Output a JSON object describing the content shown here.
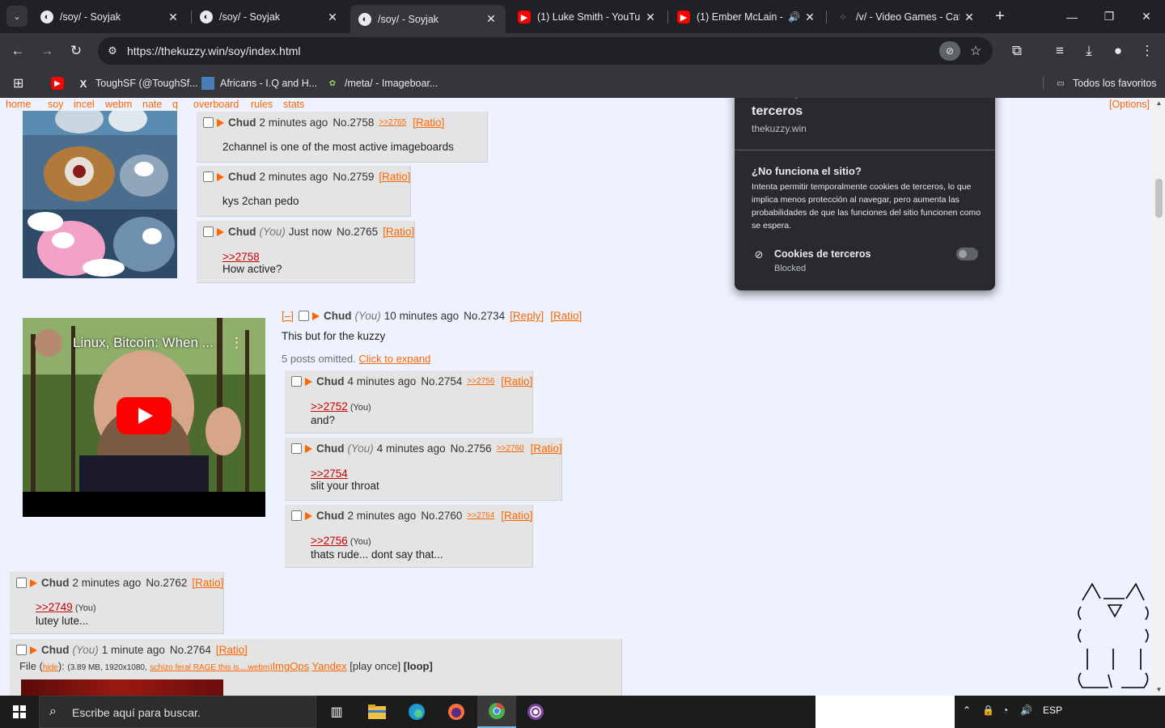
{
  "browser": {
    "tabs": [
      {
        "title": "/soy/ - Soyjak",
        "favicon": "soyjak-icon"
      },
      {
        "title": "/soy/ - Soyjak",
        "favicon": "soyjak-icon"
      },
      {
        "title": "/soy/ - Soyjak",
        "favicon": "soyjak-icon",
        "active": true
      },
      {
        "title": "(1) Luke Smith - YouTub",
        "favicon": "youtube-icon"
      },
      {
        "title": "(1) Ember McLain - ",
        "favicon": "youtube-icon",
        "audio": true
      },
      {
        "title": "/v/ - Video Games - Cat",
        "favicon": "board-icon"
      }
    ],
    "url": "https://thekuzzy.win/soy/index.html",
    "bookmarks": [
      {
        "label": "",
        "icon": "youtube-icon"
      },
      {
        "label": "ToughSF (@ToughSf...",
        "icon": "x-icon"
      },
      {
        "label": "Africans - I.Q and H...",
        "icon": "image-icon"
      },
      {
        "label": "/meta/ - Imageboar...",
        "icon": "board-icon"
      }
    ],
    "all_bookmarks": "Todos los favoritos"
  },
  "board_nav": {
    "links": [
      "home",
      "soy",
      "incel",
      "webm",
      "nate",
      "q",
      "overboard",
      "rules",
      "stats"
    ],
    "options": "[Options]"
  },
  "posts": {
    "p2758": {
      "name": "Chud",
      "time": "2 minutes ago",
      "no": "No.2758",
      "backlink": ">>2765",
      "ratio": "[Ratio]",
      "body": "2channel is one of the most active imageboards"
    },
    "p2759": {
      "name": "Chud",
      "time": "2 minutes ago",
      "no": "No.2759",
      "ratio": "[Ratio]",
      "body": "kys 2chan pedo"
    },
    "p2765": {
      "name": "Chud",
      "you": "(You)",
      "time": "Just now",
      "no": "No.2765",
      "ratio": "[Ratio]",
      "quote": ">>2758",
      "body": "How active?"
    },
    "op2734": {
      "hide": "[–]",
      "name": "Chud",
      "you": "(You)",
      "time": "10 minutes ago",
      "no": "No.2734",
      "reply": "[Reply]",
      "ratio": "[Ratio]",
      "body": "This but for the kuzzy",
      "omitted": "5 posts omitted.",
      "expand": "Click to expand",
      "video_title": "Linux, Bitcoin: When ..."
    },
    "p2754": {
      "name": "Chud",
      "time": "4 minutes ago",
      "no": "No.2754",
      "backlink": ">>2756",
      "ratio": "[Ratio]",
      "quote": ">>2752",
      "quote_you": "(You)",
      "body": "and?"
    },
    "p2756": {
      "name": "Chud",
      "you": "(You)",
      "time": "4 minutes ago",
      "no": "No.2756",
      "backlink": ">>2760",
      "ratio": "[Ratio]",
      "quote": ">>2754",
      "body": "slit your throat"
    },
    "p2760": {
      "name": "Chud",
      "time": "2 minutes ago",
      "no": "No.2760",
      "backlink": ">>2764",
      "ratio": "[Ratio]",
      "quote": ">>2756",
      "quote_you": "(You)",
      "body": "thats rude... dont say that..."
    },
    "p2762": {
      "name": "Chud",
      "time": "2 minutes ago",
      "no": "No.2762",
      "ratio": "[Ratio]",
      "quote": ">>2749",
      "quote_you": "(You)",
      "body": "lutey lute..."
    },
    "p2764": {
      "name": "Chud",
      "you": "(You)",
      "time": "1 minute ago",
      "no": "No.2764",
      "ratio": "[Ratio]",
      "file_label": "File",
      "file_hide": "hide",
      "file_meta": "(3.89 MB, 1920x1080,",
      "file_name": "schizo feral RAGE this is....webm)",
      "imgops": "ImgOps",
      "yandex": "Yandex",
      "play": "[play once]",
      "loop": "[loop]"
    }
  },
  "cookie_popup": {
    "title": "Se bloquearon las cookies de terceros",
    "site": "thekuzzy.win",
    "question": "¿No funciona el sitio?",
    "description": "Intenta permitir temporalmente cookies de terceros, lo que implica menos protección al navegar, pero aumenta las probabilidades de que las funciones del sitio funcionen como se espera.",
    "row_label": "Cookies de terceros",
    "row_status": "Blocked"
  },
  "taskbar": {
    "search_placeholder": "Escribe aquí para buscar.",
    "lang": "ESP"
  },
  "colors": {
    "accent": "#ff6600",
    "quote": "#cc0000",
    "page_bg": "#eef2ff",
    "post_bg": "#e4e4e4"
  }
}
